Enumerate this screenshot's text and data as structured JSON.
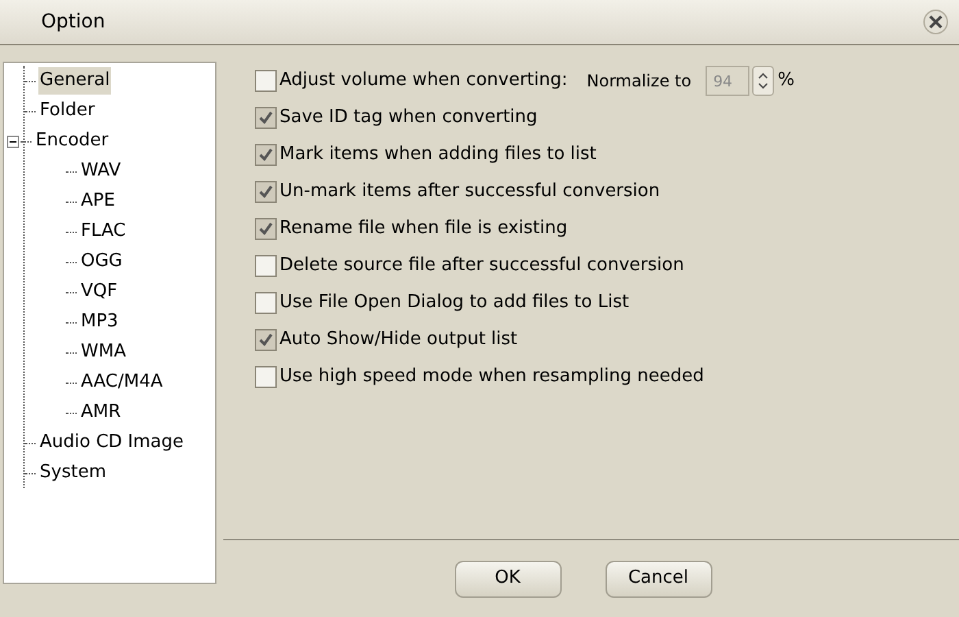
{
  "window": {
    "title": "Option"
  },
  "tree": [
    {
      "label": "General",
      "selected": true
    },
    {
      "label": "Folder",
      "selected": false
    },
    {
      "label": "Encoder",
      "selected": false,
      "expanded": true,
      "children": [
        {
          "label": "WAV",
          "selected": false
        },
        {
          "label": "APE",
          "selected": false
        },
        {
          "label": "FLAC",
          "selected": false
        },
        {
          "label": "OGG",
          "selected": false
        },
        {
          "label": "VQF",
          "selected": false
        },
        {
          "label": "MP3",
          "selected": false
        },
        {
          "label": "WMA",
          "selected": false
        },
        {
          "label": "AAC/M4A",
          "selected": false
        },
        {
          "label": "AMR",
          "selected": false
        }
      ]
    },
    {
      "label": "Audio CD Image",
      "selected": false
    },
    {
      "label": "System",
      "selected": false
    }
  ],
  "options": [
    {
      "label": "Adjust volume when converting:",
      "checked": false,
      "normalize": {
        "label": "Normalize to",
        "value": "94",
        "unit": "%",
        "disabled": true
      }
    },
    {
      "label": "Save ID tag when converting",
      "checked": true
    },
    {
      "label": "Mark items when adding files to list",
      "checked": true
    },
    {
      "label": "Un-mark items after successful conversion",
      "checked": true
    },
    {
      "label": "Rename file when file is existing",
      "checked": true
    },
    {
      "label": "Delete source file after successful conversion",
      "checked": false
    },
    {
      "label": "Use File Open Dialog to add files to List",
      "checked": false
    },
    {
      "label": "Auto Show/Hide output list",
      "checked": true
    },
    {
      "label": "Use high speed mode when resampling needed",
      "checked": false
    }
  ],
  "buttons": [
    "OK",
    "Cancel"
  ]
}
